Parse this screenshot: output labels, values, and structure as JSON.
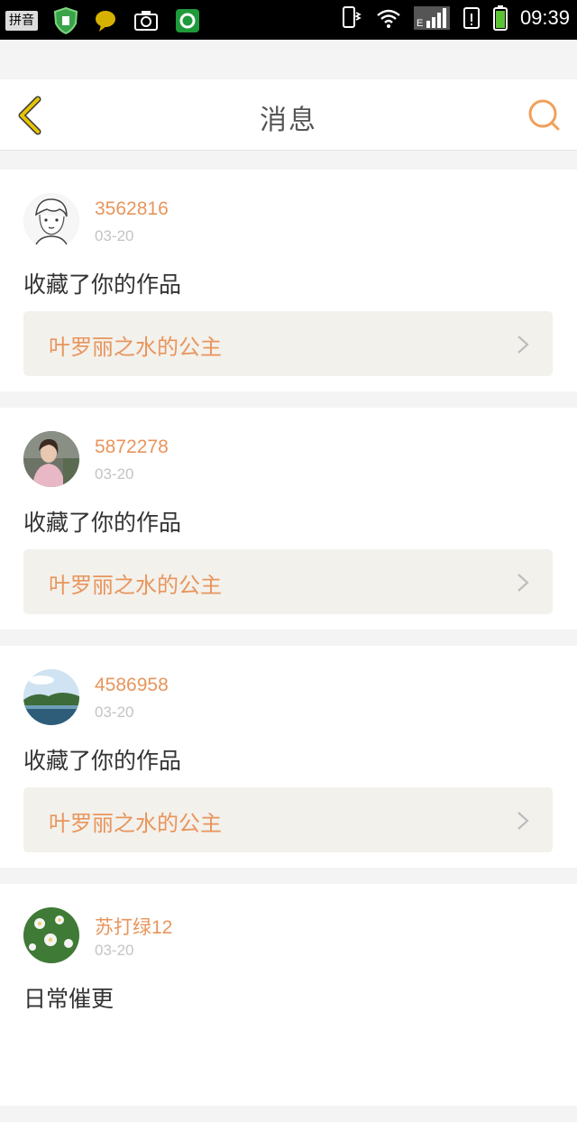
{
  "status_bar": {
    "input_method": "拼音",
    "network_label": "E",
    "time": "09:39"
  },
  "header": {
    "title": "消息",
    "back_icon": "back-chevron-icon",
    "search_icon": "search-icon"
  },
  "colors": {
    "accent": "#e8955c",
    "back_arrow": "#e6b800"
  },
  "messages": [
    {
      "username": "3562816",
      "date": "03-20",
      "action": "收藏了你的作品",
      "work_title": "叶罗丽之水的公主",
      "avatar": "sketch-portrait-avatar"
    },
    {
      "username": "5872278",
      "date": "03-20",
      "action": "收藏了你的作品",
      "work_title": "叶罗丽之水的公主",
      "avatar": "girl-photo-avatar"
    },
    {
      "username": "4586958",
      "date": "03-20",
      "action": "收藏了你的作品",
      "work_title": "叶罗丽之水的公主",
      "avatar": "landscape-avatar"
    },
    {
      "username": "苏打绿12",
      "date": "03-20",
      "action": "日常催更",
      "work_title": "",
      "avatar": "flowers-avatar"
    }
  ]
}
